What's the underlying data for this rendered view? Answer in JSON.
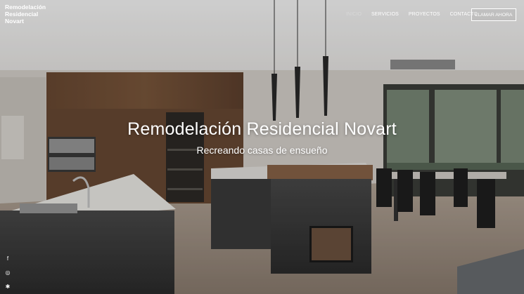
{
  "logo": {
    "line1": "Remodelación",
    "line2": "Residencial",
    "line3": "Novart"
  },
  "nav": {
    "items": [
      {
        "label": "INICIO"
      },
      {
        "label": "SERVICIOS"
      },
      {
        "label": "PROYECTOS"
      },
      {
        "label": "CONTACTO"
      }
    ],
    "cta_label": "LLAMAR AHORA"
  },
  "hero": {
    "title": "Remodelación Residencial Novart",
    "subtitle": "Recreando casas de ensueño"
  },
  "social": [
    {
      "icon": "facebook-icon",
      "glyph": "f"
    },
    {
      "icon": "instagram-icon",
      "glyph": "◎"
    },
    {
      "icon": "yelp-icon",
      "glyph": "✱"
    }
  ],
  "colors": {
    "text": "#ffffff",
    "nav_active": "#d8d8d8"
  }
}
